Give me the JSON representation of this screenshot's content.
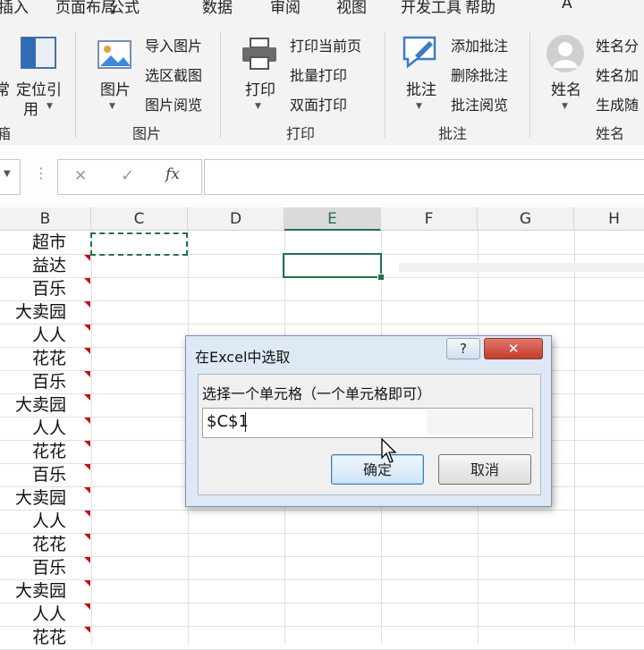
{
  "ribbon": {
    "tabs": [
      "插入",
      "页面布局",
      "公式",
      "数据",
      "审阅",
      "视图",
      "开发工具",
      "帮助",
      "A"
    ],
    "left_partial": {
      "label1": "常",
      "label2": "箱"
    },
    "locate_ref": {
      "label1": "定位引",
      "label2": "用"
    },
    "picture_group": {
      "main_label": "图片",
      "items": [
        "导入图片",
        "选区截图",
        "图片阅览"
      ],
      "group_label": "图片"
    },
    "print_group": {
      "main_label": "打印",
      "items": [
        "打印当前页",
        "批量打印",
        "双面打印"
      ],
      "group_label": "打印"
    },
    "comment_group": {
      "main_label": "批注",
      "items": [
        "添加批注",
        "删除批注",
        "批注阅览"
      ],
      "group_label": "批注"
    },
    "name_group": {
      "main_label": "姓名",
      "items": [
        "姓名分",
        "姓名加",
        "生成随"
      ],
      "group_label": "姓名"
    }
  },
  "formula_bar": {
    "cancel": "✕",
    "confirm": "✓",
    "fx": "fx",
    "value": ""
  },
  "grid": {
    "columns": [
      "B",
      "C",
      "D",
      "E",
      "F",
      "G",
      "H"
    ],
    "selected_column": "E",
    "column_b_values": [
      "超市",
      "益达",
      "百乐",
      "大卖园",
      "人人",
      "花花",
      "百乐",
      "大卖园",
      "人人",
      "花花",
      "百乐",
      "大卖园",
      "人人",
      "花花",
      "百乐",
      "大卖园",
      "人人",
      "花花"
    ]
  },
  "dialog": {
    "title": "在Excel中选取",
    "help_button": "?",
    "close_button": "✕",
    "prompt": "选择一个单元格（一个单元格即可）",
    "input_value": "$C$1",
    "ok_label": "确定",
    "cancel_label": "取消"
  },
  "colors": {
    "accent_green": "#217346",
    "comment_red": "#c0101a",
    "dialog_close_red": "#c7463a"
  }
}
